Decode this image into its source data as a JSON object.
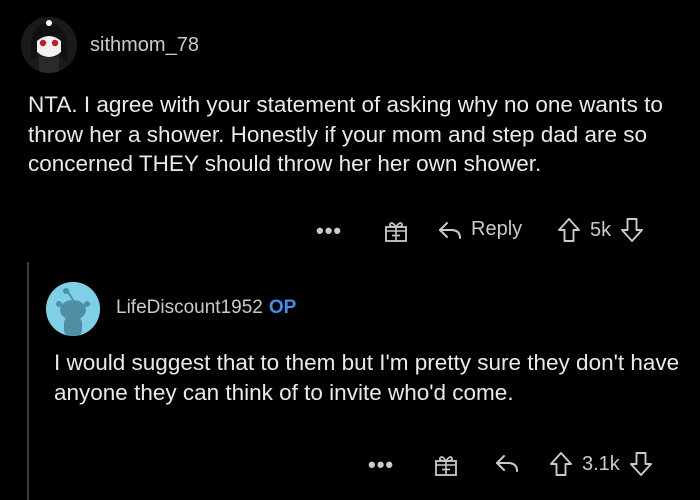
{
  "comment": {
    "username": "sithmom_78",
    "body": "NTA. I agree with your statement of asking why no one wants to throw her a shower. Honestly if your mom and step dad are so concerned THEY should throw her her own shower.",
    "actions": {
      "more": "•••",
      "reply_label": "Reply",
      "score": "5k"
    }
  },
  "reply": {
    "username": "LifeDiscount1952",
    "badge": "OP",
    "body": "I would suggest that to them but I'm pretty sure they don't have anyone they can think of to invite who'd come.",
    "actions": {
      "more": "•••",
      "score": "3.1k"
    }
  },
  "colors": {
    "background": "#000000",
    "text": "#e8eaeb",
    "meta": "#c8cbcd",
    "op_badge": "#3f8fea",
    "avatar_reply_bg": "#7fd0e6"
  },
  "icons": {
    "gift": "gift-icon",
    "reply": "reply-arrow-icon",
    "upvote": "upvote-icon",
    "downvote": "downvote-icon"
  }
}
